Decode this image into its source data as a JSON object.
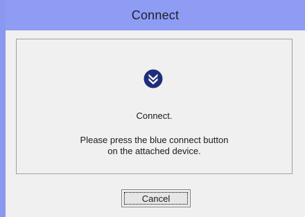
{
  "window": {
    "title": "Connect"
  },
  "dialog": {
    "icon": "download-arrows-icon",
    "heading": "Connect.",
    "message_line1": "Please press the blue connect button",
    "message_line2": "on the attached device."
  },
  "buttons": {
    "cancel_label": "Cancel"
  },
  "colors": {
    "titlebar": "#8e9cf3",
    "icon_fill": "#1f2d7a",
    "client_bg": "#f0f0f0"
  }
}
